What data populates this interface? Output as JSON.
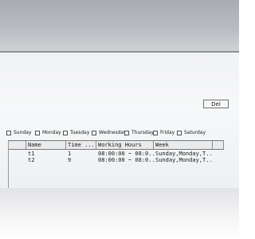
{
  "toolbar": {
    "del_label": "Del"
  },
  "days": [
    "Sunday",
    "Monday",
    "Tuesday",
    "Wednesday",
    "Thursday",
    "Friday",
    "Saturday"
  ],
  "table": {
    "columns": [
      "Name",
      "Time ...",
      "Working Hours",
      "Week"
    ],
    "rows": [
      {
        "name": "t1",
        "time": "1",
        "working_hours": "08:00:00 ~ 08:0...",
        "week": "Sunday,Monday,T..."
      },
      {
        "name": "t2",
        "time": "9",
        "working_hours": "08:00:00 ~ 08:0...",
        "week": "Sunday,Monday,T..."
      }
    ]
  }
}
